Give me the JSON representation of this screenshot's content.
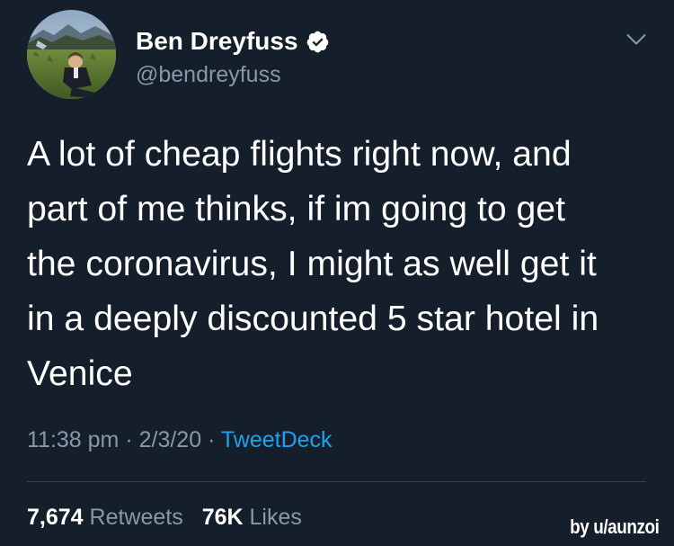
{
  "author": {
    "display_name": "Ben Dreyfuss",
    "handle": "@bendreyfuss",
    "verified": true,
    "avatar": "person-lying-in-field-photo"
  },
  "tweet": {
    "text": "A lot of cheap flights right now, and\npart of me thinks, if im going to get\nthe coronavirus, I might as well get it\nin a deeply discounted 5 star hotel in\nVenice"
  },
  "meta": {
    "time": "11:38 pm",
    "separator": " · ",
    "date": "2/3/20",
    "client": "TweetDeck"
  },
  "stats": {
    "retweets_count": "7,674",
    "retweets_label": "Retweets",
    "likes_count": "76K",
    "likes_label": "Likes"
  },
  "watermark": "by u/aunzoi",
  "icons": {
    "verified": "verified-badge-icon",
    "menu": "chevron-down-icon"
  },
  "colors": {
    "background": "#151f2b",
    "secondary_text": "#8899a6",
    "accent": "#1da1f2"
  }
}
